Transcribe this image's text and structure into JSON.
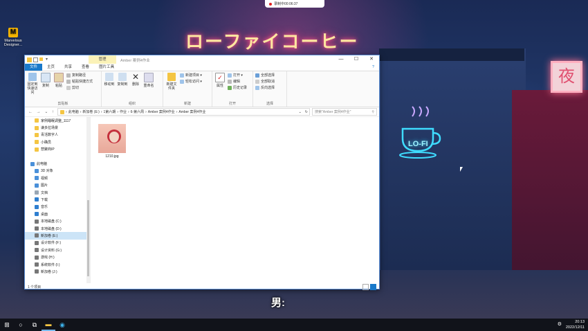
{
  "recording": {
    "label": "录制中00:06:37"
  },
  "wallpaper": {
    "neon_sign": "ローファイコーヒー",
    "cup_sign": "LO-FI",
    "lantern": "夜"
  },
  "desktop_icon": {
    "label": "Marvelous Designer..."
  },
  "subtitle": "男:",
  "window": {
    "manage_tab": "管理",
    "title": "Amber 案例4作业",
    "controls": {
      "minimize": "—",
      "maximize": "☐",
      "close": "✕"
    },
    "tabs": [
      "文件",
      "主页",
      "共享",
      "查看",
      "图片工具"
    ],
    "ribbon": {
      "clipboard": {
        "name": "剪贴板",
        "pin": "固定到快速访问",
        "copy": "复制",
        "paste": "粘贴",
        "copy_path": "复制路径",
        "paste_shortcut": "粘贴快捷方式",
        "cut": "剪切"
      },
      "organize": {
        "name": "组织",
        "move_to": "移动到",
        "copy_to": "复制到",
        "delete": "删除",
        "rename": "重命名"
      },
      "new": {
        "name": "新建",
        "new_folder": "新建文件夹",
        "new_item": "新建项目 ▾",
        "easy_access": "轻松访问 ▾"
      },
      "open": {
        "name": "打开",
        "properties": "属性",
        "open": "打开 ▾",
        "edit": "编辑",
        "history": "历史记录"
      },
      "select": {
        "name": "选择",
        "select_all": "全部选择",
        "select_none": "全部取消",
        "invert": "反向选择"
      }
    },
    "address": {
      "back": "←",
      "forward": "→",
      "recent": "⌄",
      "up": "↑",
      "path": [
        "此电脑",
        "新加卷 (E:)",
        "1第六期",
        "作业",
        "6-第六周",
        "Amber 案例4作业",
        "Amber 案例4作业"
      ],
      "refresh": "↻",
      "search_placeholder": "搜索\"Amber 案例4作业\"",
      "search_icon": "⚲"
    },
    "nav_items": [
      {
        "label": "家例睡眠调整_1117",
        "icon": "folder",
        "indent": 1
      },
      {
        "label": "谦多拉场景",
        "icon": "folder",
        "indent": 1
      },
      {
        "label": "青活数字人",
        "icon": "folder",
        "indent": 1
      },
      {
        "label": "小确员",
        "icon": "folder",
        "indent": 1
      },
      {
        "label": "悲聚商IP",
        "icon": "folder",
        "indent": 1
      },
      {
        "label": "",
        "icon": "",
        "indent": 0
      },
      {
        "label": "此电脑",
        "icon": "pc",
        "indent": 0
      },
      {
        "label": "3D 对象",
        "icon": "3d",
        "indent": 1
      },
      {
        "label": "视频",
        "icon": "video",
        "indent": 1
      },
      {
        "label": "图片",
        "icon": "picture",
        "indent": 1
      },
      {
        "label": "文档",
        "icon": "doc",
        "indent": 1
      },
      {
        "label": "下载",
        "icon": "download",
        "indent": 1
      },
      {
        "label": "音乐",
        "icon": "music",
        "indent": 1
      },
      {
        "label": "桌面",
        "icon": "desktop",
        "indent": 1
      },
      {
        "label": "本地磁盘 (C:)",
        "icon": "drive",
        "indent": 1
      },
      {
        "label": "本地磁盘 (D:)",
        "icon": "drive",
        "indent": 1
      },
      {
        "label": "新加卷 (E:)",
        "icon": "drive",
        "indent": 1,
        "selected": true
      },
      {
        "label": "设计软件 (F:)",
        "icon": "drive",
        "indent": 1
      },
      {
        "label": "设计资料 (G:)",
        "icon": "drive",
        "indent": 1
      },
      {
        "label": "游戏 (H:)",
        "icon": "drive",
        "indent": 1
      },
      {
        "label": "系统软件 (I:)",
        "icon": "drive",
        "indent": 1
      },
      {
        "label": "新加卷 (J:)",
        "icon": "drive",
        "indent": 1
      },
      {
        "label": "",
        "icon": "",
        "indent": 0
      },
      {
        "label": "网络",
        "icon": "network",
        "indent": 0
      }
    ],
    "files": [
      {
        "name": "1210.jpg"
      }
    ],
    "status": {
      "count": "1 个项目"
    }
  },
  "taskbar": {
    "start": "⊞",
    "search": "○",
    "taskview": "⧉",
    "explorer": "▬",
    "edge": "◉",
    "tray_icon": "⚙",
    "time": "20:13",
    "date": "2022/12/11"
  },
  "colors": {
    "accent": "#1979ca",
    "manage_tab": "#fbf2b8",
    "folder": "#f4c542",
    "selection": "#cce4f7",
    "taskbar": "#11131a"
  }
}
